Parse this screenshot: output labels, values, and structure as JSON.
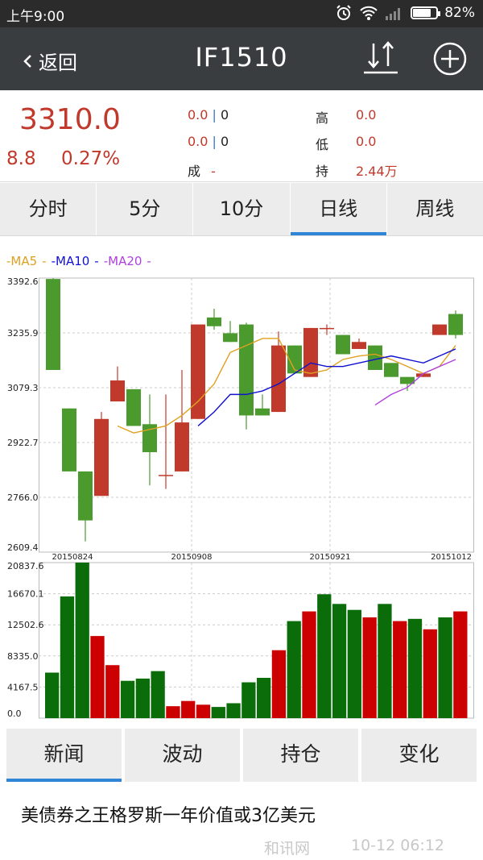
{
  "status": {
    "time": "上午9:00",
    "battery": "82%",
    "battery_level": 0.82
  },
  "header": {
    "back_label": "返回",
    "title": "IF1510",
    "sort_icon": "sort-updown-icon",
    "add_icon": "plus-circle-icon"
  },
  "quote": {
    "price": "3310.0",
    "change": "8.8",
    "change_pct": "0.27%",
    "bid_price": "0.0",
    "bid_vol": "0",
    "ask_price": "0.0",
    "ask_vol": "0",
    "vol_label": "成",
    "vol_value": "-",
    "high_label": "高",
    "high_value": "0.0",
    "low_label": "低",
    "low_value": "0.0",
    "oi_label": "持",
    "oi_value": "2.44万"
  },
  "period_tabs": [
    "分时",
    "5分",
    "10分",
    "日线",
    "周线"
  ],
  "active_period": 3,
  "colors": {
    "up": "#c0392b",
    "down": "#4a9a2e",
    "vol_up": "#cc0000",
    "vol_down": "#0a6d0a",
    "ma5": "#e0a020",
    "ma10": "#1010d0",
    "ma20": "#b040e0",
    "accent": "#2f86d6"
  },
  "chart_data": {
    "type": "candlestick",
    "legend": [
      "-MA5",
      "-MA10",
      "-MA20"
    ],
    "price_ticks": [
      "3392.6",
      "3235.9",
      "3079.3",
      "2922.7",
      "2766.0",
      "2609.4"
    ],
    "price_range": [
      2609.4,
      3392.6
    ],
    "date_labels": [
      "20150824",
      "20150908",
      "20150921",
      "20151012"
    ],
    "volume_ticks": [
      "20837.6",
      "16670.1",
      "12502.6",
      "8335.0",
      "4167.5",
      "0.0"
    ],
    "volume_range": [
      0,
      20837.6
    ],
    "candles": [
      {
        "o": 3390,
        "c": 3130,
        "h": 3392,
        "l": 3130
      },
      {
        "o": 3020,
        "c": 2840,
        "h": 3020,
        "l": 2840
      },
      {
        "o": 2840,
        "c": 2700,
        "h": 2840,
        "l": 2640
      },
      {
        "o": 2770,
        "c": 2990,
        "h": 3010,
        "l": 2770
      },
      {
        "o": 3040,
        "c": 3100,
        "h": 3140,
        "l": 3040
      },
      {
        "o": 3075,
        "c": 2970,
        "h": 3075,
        "l": 2970
      },
      {
        "o": 2975,
        "c": 2895,
        "h": 3060,
        "l": 2800
      },
      {
        "o": 2830,
        "c": 2830,
        "h": 3060,
        "l": 2790
      },
      {
        "o": 2840,
        "c": 2980,
        "h": 3130,
        "l": 2840
      },
      {
        "o": 2990,
        "c": 3260,
        "h": 3260,
        "l": 2990
      },
      {
        "o": 3280,
        "c": 3255,
        "h": 3305,
        "l": 3245
      },
      {
        "o": 3235,
        "c": 3210,
        "h": 3270,
        "l": 3210
      },
      {
        "o": 3260,
        "c": 3000,
        "h": 3265,
        "l": 2960
      },
      {
        "o": 3020,
        "c": 3000,
        "h": 3060,
        "l": 3000
      },
      {
        "o": 3010,
        "c": 3200,
        "h": 3240,
        "l": 3010
      },
      {
        "o": 3200,
        "c": 3120,
        "h": 3200,
        "l": 3120
      },
      {
        "o": 3110,
        "c": 3250,
        "h": 3250,
        "l": 3110
      },
      {
        "o": 3250,
        "c": 3250,
        "h": 3260,
        "l": 3230
      },
      {
        "o": 3230,
        "c": 3175,
        "h": 3230,
        "l": 3175
      },
      {
        "o": 3190,
        "c": 3210,
        "h": 3220,
        "l": 3190
      },
      {
        "o": 3200,
        "c": 3130,
        "h": 3200,
        "l": 3130
      },
      {
        "o": 3150,
        "c": 3110,
        "h": 3150,
        "l": 3110
      },
      {
        "o": 3110,
        "c": 3090,
        "h": 3110,
        "l": 3070
      },
      {
        "o": 3110,
        "c": 3120,
        "h": 3120,
        "l": 3110
      },
      {
        "o": 3230,
        "c": 3260,
        "h": 3260,
        "l": 3230
      },
      {
        "o": 3290,
        "c": 3230,
        "h": 3300,
        "l": 3220
      }
    ],
    "ma5": [
      null,
      null,
      null,
      null,
      2970,
      2950,
      2960,
      2970,
      3000,
      3040,
      3090,
      3180,
      3200,
      3220,
      3220,
      3130,
      3120,
      3130,
      3160,
      3170,
      3175,
      3160,
      3140,
      3120,
      3140,
      3200
    ],
    "ma10": [
      null,
      null,
      null,
      null,
      null,
      null,
      null,
      null,
      null,
      2970,
      3010,
      3060,
      3060,
      3070,
      3090,
      3120,
      3150,
      3140,
      3140,
      3150,
      3160,
      3170,
      3160,
      3150,
      3170,
      3190
    ],
    "ma20": [
      null,
      null,
      null,
      null,
      null,
      null,
      null,
      null,
      null,
      null,
      null,
      null,
      null,
      null,
      null,
      null,
      null,
      null,
      null,
      null,
      3030,
      3060,
      3080,
      3120,
      3140,
      3160
    ],
    "volumes": [
      6100,
      16300,
      20837,
      11000,
      7100,
      5000,
      5300,
      6300,
      1600,
      2300,
      1800,
      1500,
      2000,
      4800,
      5400,
      9100,
      13000,
      14300,
      16600,
      15300,
      14500,
      13500,
      15300,
      13000,
      13300,
      11900,
      13500,
      14300
    ]
  },
  "bottom_tabs": [
    "新闻",
    "波动",
    "持仓",
    "变化"
  ],
  "active_bottom": 0,
  "news": {
    "headline": "美债券之王格罗斯一年价值或3亿美元",
    "source": "和讯网",
    "time": "10-12 06:12"
  }
}
